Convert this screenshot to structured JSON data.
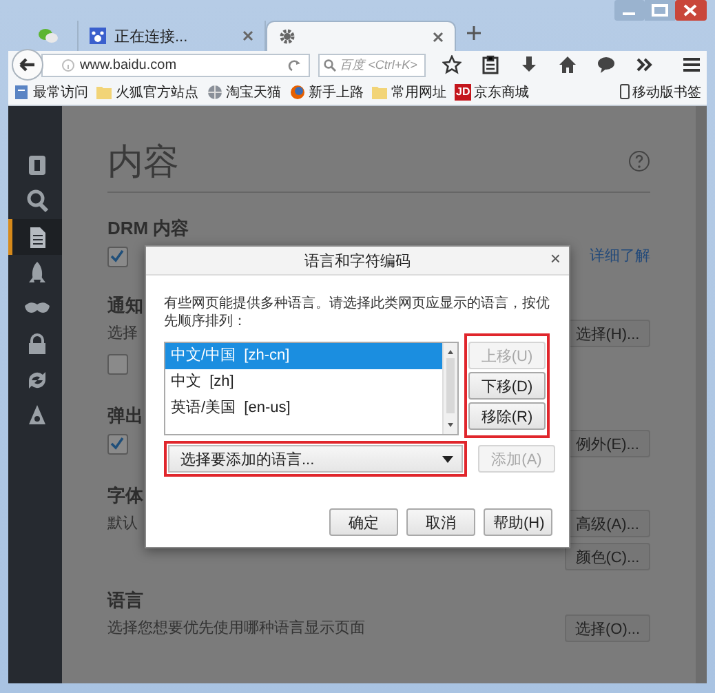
{
  "tabs": [
    {
      "kind": "chat",
      "selected": false
    },
    {
      "kind": "page",
      "label": "正在连接...",
      "selected": false
    },
    {
      "kind": "settings",
      "selected": true
    }
  ],
  "address_bar": {
    "value": "www.baidu.com"
  },
  "search_field": {
    "placeholder": "百度 <Ctrl+K>"
  },
  "bookmarks": [
    {
      "kind": "doc",
      "label": "最常访问"
    },
    {
      "kind": "folder",
      "label": "火狐官方站点"
    },
    {
      "kind": "globe",
      "label": "淘宝天猫"
    },
    {
      "kind": "fox",
      "label": "新手上路"
    },
    {
      "kind": "folder",
      "label": "常用网址"
    },
    {
      "kind": "badge",
      "badge": "JD",
      "label": "京东商城"
    }
  ],
  "mobile_bookmarks": "移动版书签",
  "sidebar": {
    "items": [
      {
        "kind": "general",
        "selected": false
      },
      {
        "kind": "search",
        "selected": false
      },
      {
        "kind": "content",
        "selected": true
      },
      {
        "kind": "apps",
        "selected": false
      },
      {
        "kind": "privacy",
        "selected": false
      },
      {
        "kind": "security",
        "selected": false
      },
      {
        "kind": "sync",
        "selected": false
      },
      {
        "kind": "advanced",
        "selected": false
      }
    ]
  },
  "page": {
    "title": "内容",
    "sections": [
      {
        "title": "DRM 内容",
        "rows": [
          {
            "kind": "checkbox",
            "checked": true,
            "link": "详细了解"
          }
        ]
      },
      {
        "title": "通知",
        "rows": [
          {
            "kind": "text",
            "text": "选择",
            "buttons": [
              "选择(H)..."
            ]
          },
          {
            "kind": "checkbox",
            "checked": false
          }
        ]
      },
      {
        "title": "弹出",
        "rows": [
          {
            "kind": "checkbox",
            "checked": true,
            "buttons": [
              "例外(E)..."
            ]
          }
        ]
      },
      {
        "title": "字体",
        "rows": [
          {
            "kind": "text",
            "text": "默认",
            "buttons": [
              "高级(A)...",
              "颜色(C)..."
            ]
          }
        ]
      },
      {
        "title": "语言",
        "rows": [
          {
            "kind": "text",
            "text": "选择您想要优先使用哪种语言显示页面",
            "buttons": [
              "选择(O)..."
            ]
          }
        ]
      }
    ]
  },
  "dialog": {
    "title": "语言和字符编码",
    "close": "×",
    "description": "有些网页能提供多种语言。请选择此类网页应显示的语言，按优先顺序排列：",
    "languages": [
      {
        "label": "中文/中国  [zh-cn]",
        "selected": true
      },
      {
        "label": "中文  [zh]",
        "selected": false
      },
      {
        "label": "英语/美国  [en-us]",
        "selected": false
      }
    ],
    "side_buttons": [
      {
        "label": "上移(U)",
        "disabled": true
      },
      {
        "label": "下移(D)",
        "disabled": false
      },
      {
        "label": "移除(R)",
        "disabled": false
      }
    ],
    "language_select": {
      "placeholder": "选择要添加的语言..."
    },
    "add_button": {
      "label": "添加(A)",
      "disabled": true
    },
    "buttons": [
      "确定",
      "取消",
      "帮助(H)"
    ]
  }
}
